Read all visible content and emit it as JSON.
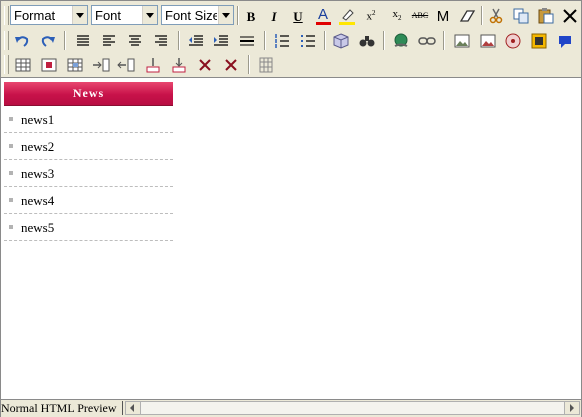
{
  "toolbar": {
    "format_select": {
      "value": "Format"
    },
    "font_select": {
      "value": "Font"
    },
    "fontsize_select": {
      "value": "Font Size"
    },
    "row1_icons": [
      "bold-icon",
      "italic-icon",
      "underline-icon",
      "font-color-icon",
      "highlight-icon",
      "superscript-icon",
      "subscript-icon",
      "strikethrough-icon",
      "remove-format-icon",
      "eraser-icon",
      "cut-icon",
      "copy-icon",
      "paste-icon",
      "delete-icon"
    ],
    "row1_text": {
      "bold": "B",
      "italic": "I",
      "underline": "U",
      "font_color": "A",
      "superscript": "x",
      "superscript_sup": "2",
      "subscript": "x",
      "subscript_sub": "2",
      "strikethrough": "ABC",
      "remove_format": "M"
    },
    "row2_icons": [
      "undo-icon",
      "redo-icon",
      "align-justify-icon",
      "align-left-icon",
      "align-center-icon",
      "align-right-icon",
      "outdent-icon",
      "indent-icon",
      "horizontal-rule-icon",
      "ordered-list-icon",
      "unordered-list-icon",
      "insert-object-icon",
      "find-icon",
      "link-icon",
      "unlink-icon",
      "image-icon",
      "image-properties-icon",
      "media-icon",
      "flash-icon",
      "help-icon"
    ],
    "row3_icons": [
      "insert-table-icon",
      "table-properties-icon",
      "cell-properties-icon",
      "insert-column-icon",
      "delete-column-icon",
      "insert-row-icon",
      "delete-row-icon",
      "merge-cells-icon",
      "split-cells-icon",
      "toggle-borders-icon"
    ],
    "colors": {
      "font_color_bar": "#e00000",
      "highlight_bar": "#ffe600"
    }
  },
  "news": {
    "title": "News",
    "items": [
      "news1",
      "news2",
      "news3",
      "news4",
      "news5"
    ]
  },
  "status": {
    "modes": "Normal HTML Preview"
  }
}
